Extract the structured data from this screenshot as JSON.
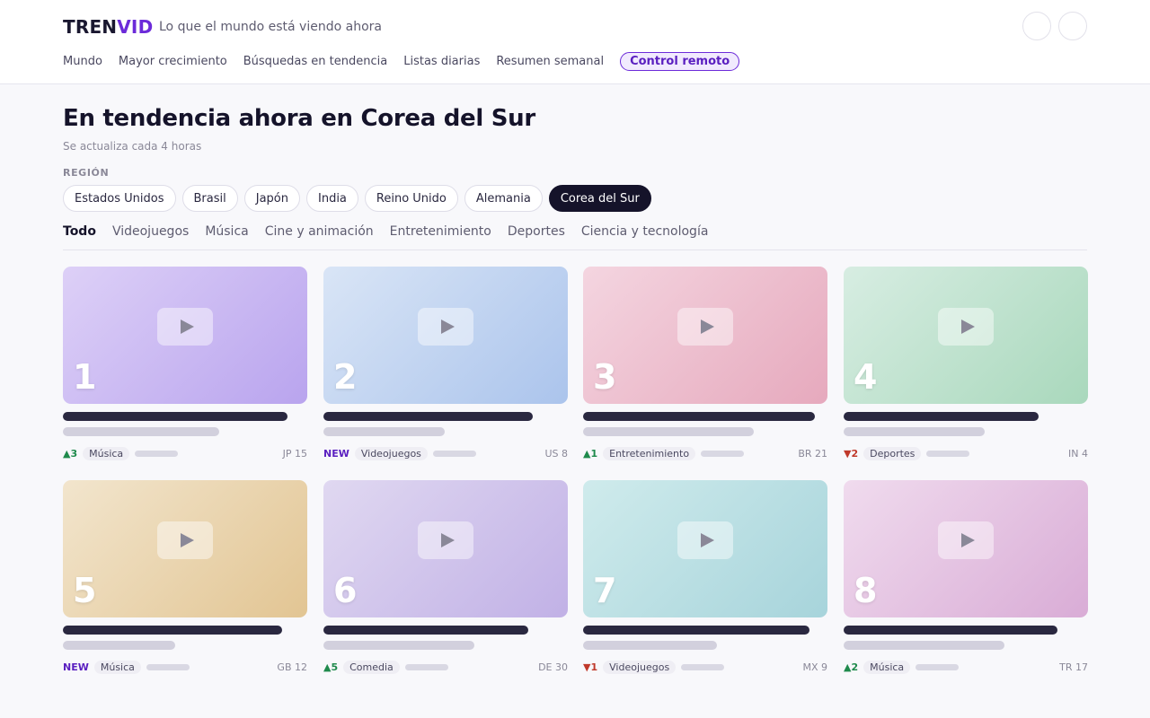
{
  "brand": {
    "part1": "TREN",
    "part2": "VID"
  },
  "tagline": "Lo que el mundo está viendo ahora",
  "nav": {
    "items": [
      "Mundo",
      "Mayor crecimiento",
      "Búsquedas en tendencia",
      "Listas diarias",
      "Resumen semanal"
    ],
    "pill": "Control remoto"
  },
  "page": {
    "title": "En tendencia ahora en Corea del Sur",
    "subtitle": "Se actualiza cada 4 horas",
    "region_label": "REGIÓN"
  },
  "regions": {
    "items": [
      "Estados Unidos",
      "Brasil",
      "Japón",
      "India",
      "Reino Unido",
      "Alemania",
      "Corea del Sur"
    ],
    "selected": "Corea del Sur"
  },
  "categories": {
    "items": [
      "Todo",
      "Videojuegos",
      "Música",
      "Cine y animación",
      "Entretenimiento",
      "Deportes",
      "Ciencia y tecnología"
    ],
    "selected": "Todo"
  },
  "colors": {
    "accent": "#6c2bd9",
    "up": "#1f8a4c",
    "down": "#c0392b"
  },
  "videos": [
    {
      "rank": "1",
      "trend": "▲3",
      "trend_type": "up",
      "tag": "Música",
      "country": "JP 15",
      "grad": [
        "#ddd0f7",
        "#b9a4ee"
      ]
    },
    {
      "rank": "2",
      "trend": "NEW",
      "trend_type": "new",
      "tag": "Videojuegos",
      "country": "US 8",
      "grad": [
        "#d9e5f6",
        "#abc4ec"
      ]
    },
    {
      "rank": "3",
      "trend": "▲1",
      "trend_type": "up",
      "tag": "Entretenimiento",
      "country": "BR 21",
      "grad": [
        "#f4d5e0",
        "#e6a9bd"
      ]
    },
    {
      "rank": "4",
      "trend": "▼2",
      "trend_type": "down",
      "tag": "Deportes",
      "country": "IN 4",
      "grad": [
        "#d7ede2",
        "#a9d8bc"
      ]
    },
    {
      "rank": "5",
      "trend": "NEW",
      "trend_type": "new",
      "tag": "Música",
      "country": "GB 12",
      "grad": [
        "#f2e5cd",
        "#e2c593"
      ]
    },
    {
      "rank": "6",
      "trend": "▲5",
      "trend_type": "up",
      "tag": "Comedia",
      "country": "DE 30",
      "grad": [
        "#e0d8f1",
        "#c1b1e6"
      ]
    },
    {
      "rank": "7",
      "trend": "▼1",
      "trend_type": "down",
      "tag": "Videojuegos",
      "country": "MX 9",
      "grad": [
        "#cfebec",
        "#a7d4db"
      ]
    },
    {
      "rank": "8",
      "trend": "▲2",
      "trend_type": "up",
      "tag": "Música",
      "country": "TR 17",
      "grad": [
        "#f0dbee",
        "#d9acd6"
      ]
    }
  ]
}
